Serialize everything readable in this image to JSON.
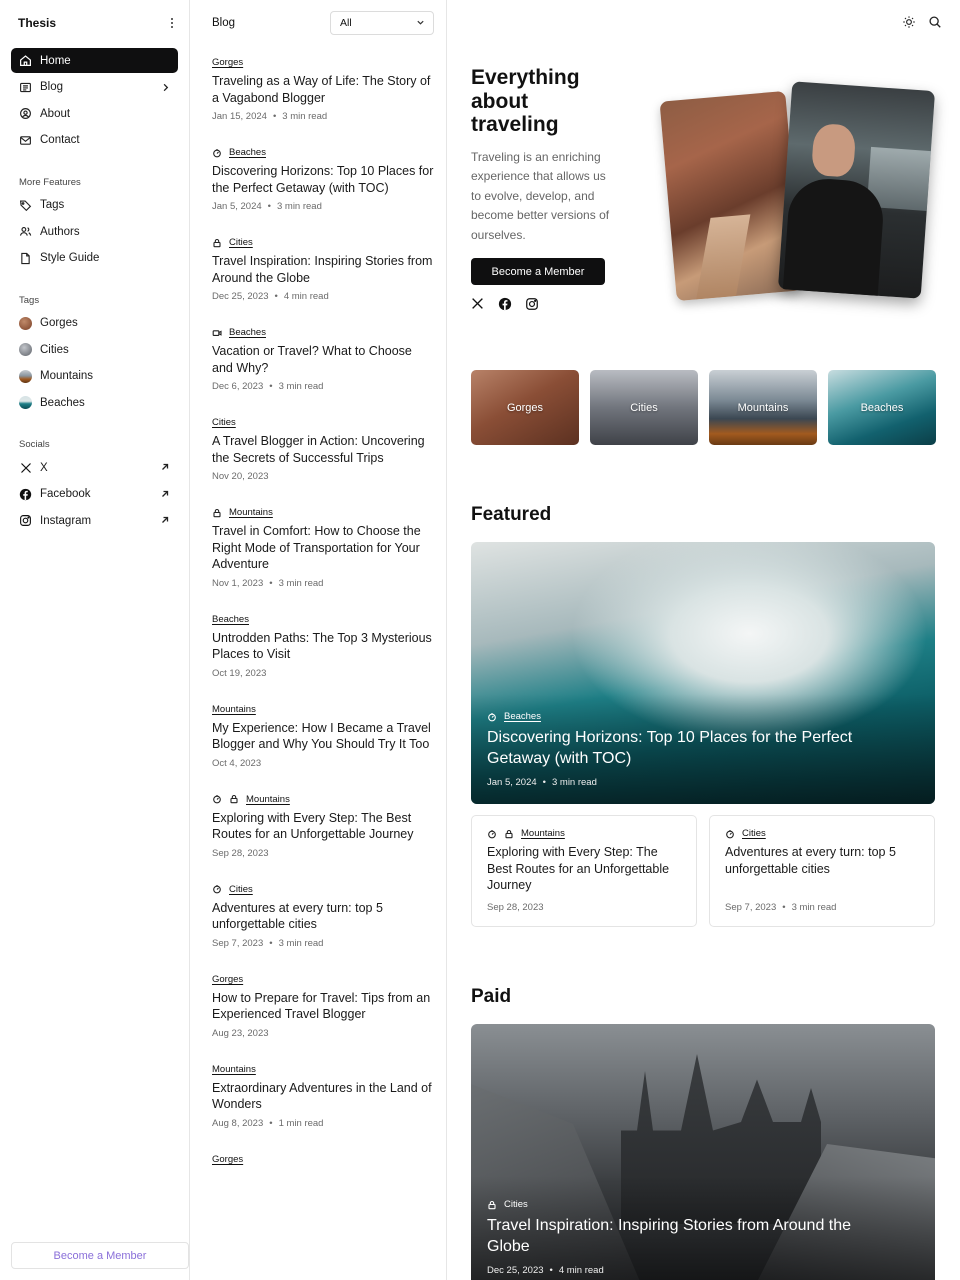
{
  "sidebar": {
    "brand": "Thesis",
    "nav": [
      {
        "label": "Home"
      },
      {
        "label": "Blog"
      },
      {
        "label": "About"
      },
      {
        "label": "Contact"
      }
    ],
    "more_features_title": "More Features",
    "more_features": [
      {
        "label": "Tags"
      },
      {
        "label": "Authors"
      },
      {
        "label": "Style Guide"
      }
    ],
    "tags_title": "Tags",
    "tags": [
      {
        "label": "Gorges",
        "color": "#9a5a3c"
      },
      {
        "label": "Cities",
        "color": "#7b8088"
      },
      {
        "label": "Mountains",
        "color": "#8a5a2e"
      },
      {
        "label": "Beaches",
        "color": "#1f7f88"
      }
    ],
    "socials_title": "Socials",
    "socials": [
      {
        "label": "X",
        "icon": "x-icon"
      },
      {
        "label": "Facebook",
        "icon": "facebook-icon"
      },
      {
        "label": "Instagram",
        "icon": "instagram-icon"
      }
    ],
    "cta": "Become a Member"
  },
  "blog": {
    "title": "Blog",
    "filter": "All",
    "posts": [
      {
        "cats": "Gorges",
        "title": "Traveling as a Way of Life: The Story of a Vagabond Blogger",
        "date": "Jan 15, 2024",
        "read": "3 min read",
        "icons": []
      },
      {
        "cats": "Beaches",
        "title": "Discovering Horizons: Top 10 Places for the Perfect Getaway (with TOC)",
        "date": "Jan 5, 2024",
        "read": "3 min read",
        "icons": [
          "featured"
        ]
      },
      {
        "cats": "Cities",
        "title": "Travel Inspiration: Inspiring Stories from Around the Globe",
        "date": "Dec 25, 2023",
        "read": "4 min read",
        "icons": [
          "lock"
        ]
      },
      {
        "cats": "Beaches",
        "title": "Vacation or Travel? What to Choose and Why?",
        "date": "Dec 6, 2023",
        "read": "3 min read",
        "icons": [
          "video"
        ]
      },
      {
        "cats": "Cities",
        "title": "A Travel Blogger in Action: Uncovering the Secrets of Successful Trips",
        "date": "Nov 20, 2023",
        "read": "",
        "icons": []
      },
      {
        "cats": "Mountains",
        "title": "Travel in Comfort: How to Choose the Right Mode of Transportation for Your Adventure",
        "date": "Nov 1, 2023",
        "read": "3 min read",
        "icons": [
          "lock"
        ]
      },
      {
        "cats": "Beaches",
        "title": "Untrodden Paths: The Top 3 Mysterious Places to Visit",
        "date": "Oct 19, 2023",
        "read": "",
        "icons": []
      },
      {
        "cats": "Mountains",
        "title": "My Experience: How I Became a Travel Blogger and Why You Should Try It Too",
        "date": "Oct 4, 2023",
        "read": "",
        "icons": []
      },
      {
        "cats": "Mountains",
        "title": "Exploring with Every Step: The Best Routes for an Unforgettable Journey",
        "date": "Sep 28, 2023",
        "read": "",
        "icons": [
          "featured",
          "lock"
        ]
      },
      {
        "cats": "Cities",
        "title": "Adventures at every turn: top 5 unforgettable cities",
        "date": "Sep 7, 2023",
        "read": "3 min read",
        "icons": [
          "featured"
        ]
      },
      {
        "cats": "Gorges",
        "title": "How to Prepare for Travel: Tips from an Experienced Travel Blogger",
        "date": "Aug 23, 2023",
        "read": "",
        "icons": []
      },
      {
        "cats": "Mountains",
        "title": "Extraordinary Adventures in the Land of Wonders",
        "date": "Aug 8, 2023",
        "read": "1 min read",
        "icons": []
      },
      {
        "cats": "Gorges",
        "title": "",
        "date": "",
        "read": "",
        "icons": []
      }
    ]
  },
  "hero": {
    "title": "Everything about traveling",
    "description": "Traveling is an enriching experience that allows us to evolve, develop, and become better versions of ourselves.",
    "cta": "Become a Member"
  },
  "tag_cards": [
    "Gorges",
    "Cities",
    "Mountains",
    "Beaches"
  ],
  "featured": {
    "heading": "Featured",
    "big": {
      "cat": "Beaches",
      "title": "Discovering Horizons: Top 10 Places for the Perfect Getaway (with TOC)",
      "date": "Jan 5, 2024",
      "read": "3 min read"
    },
    "cards": [
      {
        "cat": "Mountains",
        "title": "Exploring with Every Step: The Best Routes for an Unforgettable Journey",
        "date": "Sep 28, 2023",
        "read": ""
      },
      {
        "cat": "Cities",
        "title": "Adventures at every turn: top 5 unforgettable cities",
        "date": "Sep 7, 2023",
        "read": "3 min read"
      }
    ]
  },
  "paid": {
    "heading": "Paid",
    "big": {
      "cat": "Cities",
      "title": "Travel Inspiration: Inspiring Stories from Around the Globe",
      "date": "Dec 25, 2023",
      "read": "4 min read"
    }
  },
  "colors": {
    "accent": "#0f0f10",
    "cta_text": "#8a6fd9"
  }
}
